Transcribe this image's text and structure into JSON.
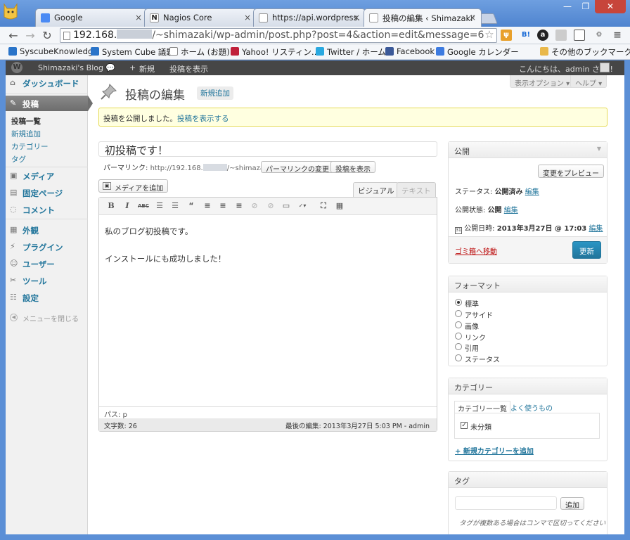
{
  "browser": {
    "tabs": [
      {
        "label": "Google",
        "icon": "google-icon",
        "color": "#4a8af4"
      },
      {
        "label": "Nagios Core",
        "icon": "nagios-icon",
        "color": "#222222"
      },
      {
        "label": "https://api.wordpress.o",
        "icon": "page-icon",
        "color": "#ffffff"
      },
      {
        "label": "投稿の編集 ‹ Shimazaki'",
        "icon": "page-icon",
        "color": "#ffffff"
      }
    ],
    "url_host": "192.168.",
    "url_path": "/~shimazaki/wp-admin/post.php?post=4&action=edit&message=6",
    "bookmarks": [
      {
        "label": "SyscubeKnowledge",
        "color": "#2a74c9"
      },
      {
        "label": "System Cube 議題",
        "color": "#2a74c9"
      },
      {
        "label": "ホーム (お題)",
        "color": "#ffffff"
      },
      {
        "label": "Yahoo! リスティン…",
        "color": "#c0203a"
      },
      {
        "label": "Twitter / ホーム",
        "color": "#2aa9e0"
      },
      {
        "label": "Facebook",
        "color": "#3b5998"
      },
      {
        "label": "Google カレンダー",
        "color": "#3d7be0"
      },
      {
        "label": "その他のブックマーク",
        "color": "#e9b84a"
      }
    ],
    "ext_labels": [
      "B!",
      "a"
    ]
  },
  "adminbar": {
    "site": "Shimazaki's Blog",
    "new": "新規",
    "view": "投稿を表示",
    "greeting": "こんにちは、admin さん !"
  },
  "sidebar": {
    "dashboard": "ダッシュボード",
    "posts": "投稿",
    "subitems": [
      "投稿一覧",
      "新規追加",
      "カテゴリー",
      "タグ"
    ],
    "media": "メディア",
    "pages": "固定ページ",
    "comments": "コメント",
    "appearance": "外観",
    "plugins": "プラグイン",
    "users": "ユーザー",
    "tools": "ツール",
    "settings": "設定",
    "collapse": "メニューを閉じる"
  },
  "main": {
    "screen_options": "表示オプション ▾",
    "help": "ヘルプ ▾",
    "title": "投稿の編集",
    "add_new": "新規追加",
    "notice_text": "投稿を公開しました。",
    "notice_link": "投稿を表示する",
    "post_title": "初投稿です！",
    "permalink_label": "パーマリンク:",
    "permalink_url_a": "http://192.168.",
    "permalink_url_b": "/~shimazaki/?p=4",
    "change_permalink": "パーマリンクの変更",
    "view_post": "投稿を表示",
    "add_media": "メディアを追加",
    "tab_visual": "ビジュアル",
    "tab_text": "テキスト",
    "content": [
      "私のブログ初投稿です。",
      "インストールにも成功しました！"
    ],
    "path": "パス: p",
    "wordcount": "文字数: 26",
    "last_edit": "最後の編集: 2013年3月27日 5:03 PM - admin"
  },
  "publish": {
    "heading": "公開",
    "preview": "変更をプレビュー",
    "status_label": "ステータス:",
    "status_value": "公開済み",
    "visibility_label": "公開状態:",
    "visibility_value": "公開",
    "date_label": "公開日時:",
    "date_value": "2013年3月27日 @ 17:03",
    "edit": "編集",
    "trash": "ゴミ箱へ移動",
    "update": "更新"
  },
  "format": {
    "heading": "フォーマット",
    "options": [
      "標準",
      "アサイド",
      "画像",
      "リンク",
      "引用",
      "ステータス"
    ],
    "selected": 0
  },
  "categories": {
    "heading": "カテゴリー",
    "tab_all": "カテゴリー一覧",
    "tab_popular": "よく使うもの",
    "items": [
      "未分類"
    ],
    "add_new": "+ 新規カテゴリーを追加"
  },
  "tags": {
    "heading": "タグ",
    "add": "追加",
    "hint": "タグが複数ある場合はコンマで区切ってください"
  }
}
